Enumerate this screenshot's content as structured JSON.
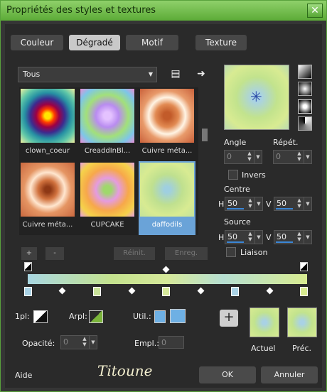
{
  "window": {
    "title": "Propriétés des styles et textures",
    "close": "✕"
  },
  "tabs": [
    {
      "label": "Couleur"
    },
    {
      "label": "Dégradé"
    },
    {
      "label": "Motif"
    },
    {
      "label": "Texture"
    }
  ],
  "filter": {
    "value": "Tous"
  },
  "gradients": [
    {
      "name": "clown_coeur"
    },
    {
      "name": "CreaddInBl..."
    },
    {
      "name": "Cuivre méta..."
    },
    {
      "name": "Cuivre méta..."
    },
    {
      "name": "CUPCAKE"
    },
    {
      "name": "daffodils"
    }
  ],
  "buttons": {
    "add": "+",
    "remove": "-",
    "reset": "Réinit.",
    "save": "Enreg."
  },
  "angle": {
    "label": "Angle",
    "value": "0"
  },
  "repeat": {
    "label": "Répét.",
    "value": "0"
  },
  "invert": {
    "label": "Invers"
  },
  "center": {
    "label": "Centre",
    "h_label": "H",
    "h": "50",
    "v_label": "V",
    "v": "50"
  },
  "source": {
    "label": "Source",
    "h_label": "H",
    "h": "50",
    "v_label": "V",
    "v": "50"
  },
  "link": {
    "label": "Liaison"
  },
  "bottom": {
    "one_pl": "1pl:",
    "arpl": "Arpl:",
    "util": "Util.:",
    "opacity_label": "Opacité:",
    "opacity": "0",
    "empl_label": "Empl.:",
    "empl": "0",
    "plus": "+",
    "actual": "Actuel",
    "prev": "Préc."
  },
  "footer": {
    "help": "Aide",
    "signature": "Titoune",
    "ok": "OK",
    "cancel": "Annuler"
  },
  "colors": {
    "accent": "#5cab37",
    "selection": "#6aa3d8"
  }
}
